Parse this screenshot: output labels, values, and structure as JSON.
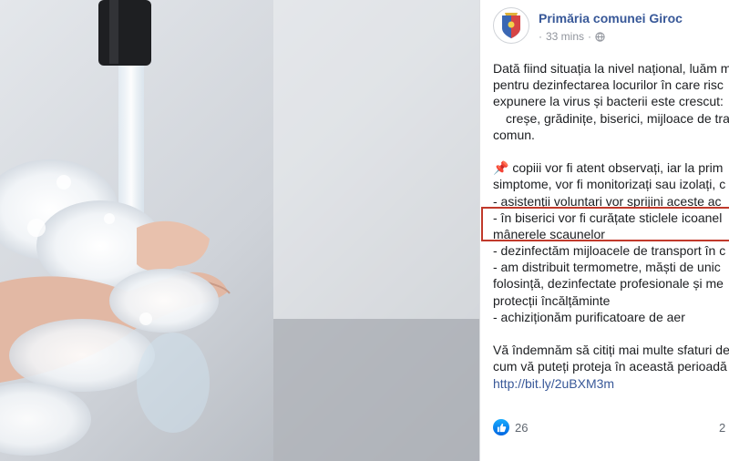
{
  "post": {
    "page_name": "Primăria comunei Giroc",
    "time": "33 mins",
    "separator": "·",
    "privacy_icon": "globe-icon",
    "lines": [
      "Dată fiind situația la nivel național, luăm m",
      "pentru dezinfectarea locurilor în care risc",
      "expunere la virus și bacterii este crescut:",
      "creșe, grădinițe, biserici, mijloace de tran",
      "comun.",
      "",
      "📌 copiii vor fi atent observați, iar la prim",
      "simptome, vor fi monitorizați sau izolați, c",
      "- asistenții voluntari vor sprijini aceste ac",
      "- în biserici vor fi curățate sticlele icoanel",
      "mânerele scaunelor",
      "- dezinfectăm mijloacele de transport în c",
      "- am distribuit termometre, măști de unic",
      "folosință, dezinfectate profesionale și me",
      "protecții încălțăminte",
      "- achiziționăm purificatoare de aer",
      "",
      "Vă îndemnăm să citiți mai multe sfaturi de",
      "cum vă puteți proteja în această perioadă"
    ],
    "link": "http://bit.ly/2uBXM3m",
    "reaction_icon": "like-icon",
    "reactions_count": "26",
    "comments_count": "2"
  },
  "colors": {
    "page_name": "#385898",
    "link": "#385898",
    "highlight_border": "#c0392b",
    "meta": "#90949c"
  }
}
